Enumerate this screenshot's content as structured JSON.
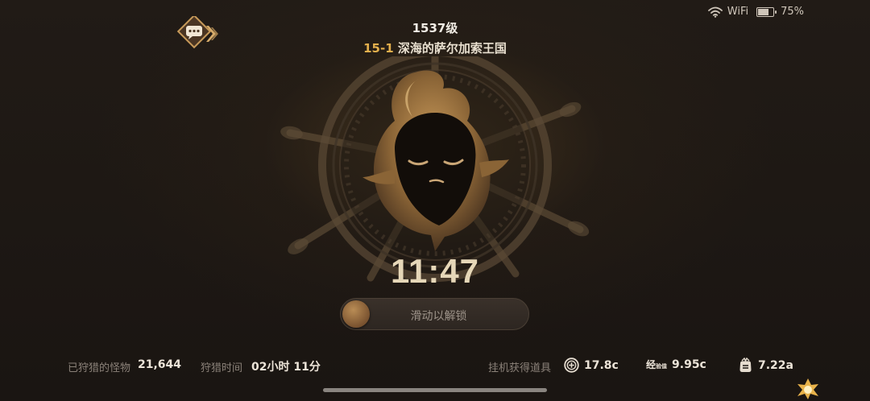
{
  "status_bar": {
    "wifi_label": "WiFi",
    "battery_percent_text": "75%",
    "battery_level": 0.75
  },
  "header": {
    "level": "1537级",
    "stage_id": "15-1",
    "stage_name": "深海的萨尔加索王国"
  },
  "clock": "11:47",
  "unlock": {
    "label": "滑动以解锁"
  },
  "stats": {
    "monsters_label": "已狩猎的怪物",
    "monsters_value": "21,644",
    "hunt_time_label": "狩猎时间",
    "hunt_time_value": "02小时 11分",
    "idle_items_label": "挂机获得道具",
    "coins_value": "17.8c",
    "exp_icon_main": "经",
    "exp_icon_sub": "验值",
    "exp_value": "9.95c",
    "items_value": "7.22a"
  },
  "colors": {
    "accent_gold": "#e4b04d",
    "background": "#1b1613"
  },
  "icons": [
    "wifi-icon",
    "battery-icon",
    "chat-icon",
    "ship-wheel-emblem",
    "coin-icon",
    "exp-icon",
    "item-bag-icon",
    "gold-badge-icon"
  ]
}
